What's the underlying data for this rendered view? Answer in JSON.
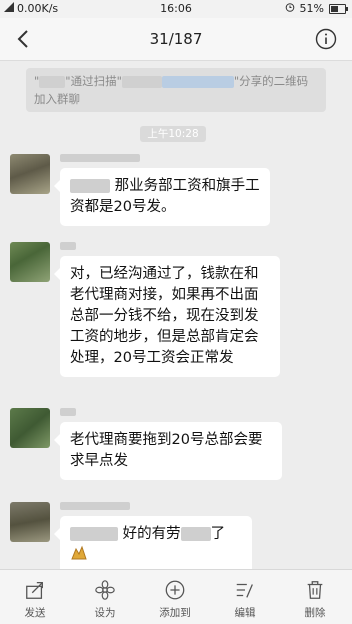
{
  "status_bar": {
    "speed": "0.00K/s",
    "time": "16:06",
    "battery": "51%",
    "battery_level": 0.51
  },
  "nav": {
    "title": "31/187"
  },
  "system_notice": {
    "part1": "\"",
    "part2": "\"通过扫描\"",
    "part3": "\"分享的二维码加入群聊"
  },
  "timestamp": "上午10:28",
  "messages": [
    {
      "text": "那业务部工资和旗手工资都是20号发。"
    },
    {
      "text": "对，已经沟通过了，钱款在和老代理商对接，如果再不出面总部一分钱不给，现在没到发工资的地步，但是总部肯定会处理，20号工资会正常发"
    },
    {
      "text": "老代理商要拖到20号总部会要求早点发"
    },
    {
      "text_a": "好的有劳",
      "text_b": "了"
    }
  ],
  "toolbar": {
    "send": "发送",
    "favorite": "设为",
    "add": "添加到",
    "edit": "编辑",
    "delete": "删除"
  }
}
